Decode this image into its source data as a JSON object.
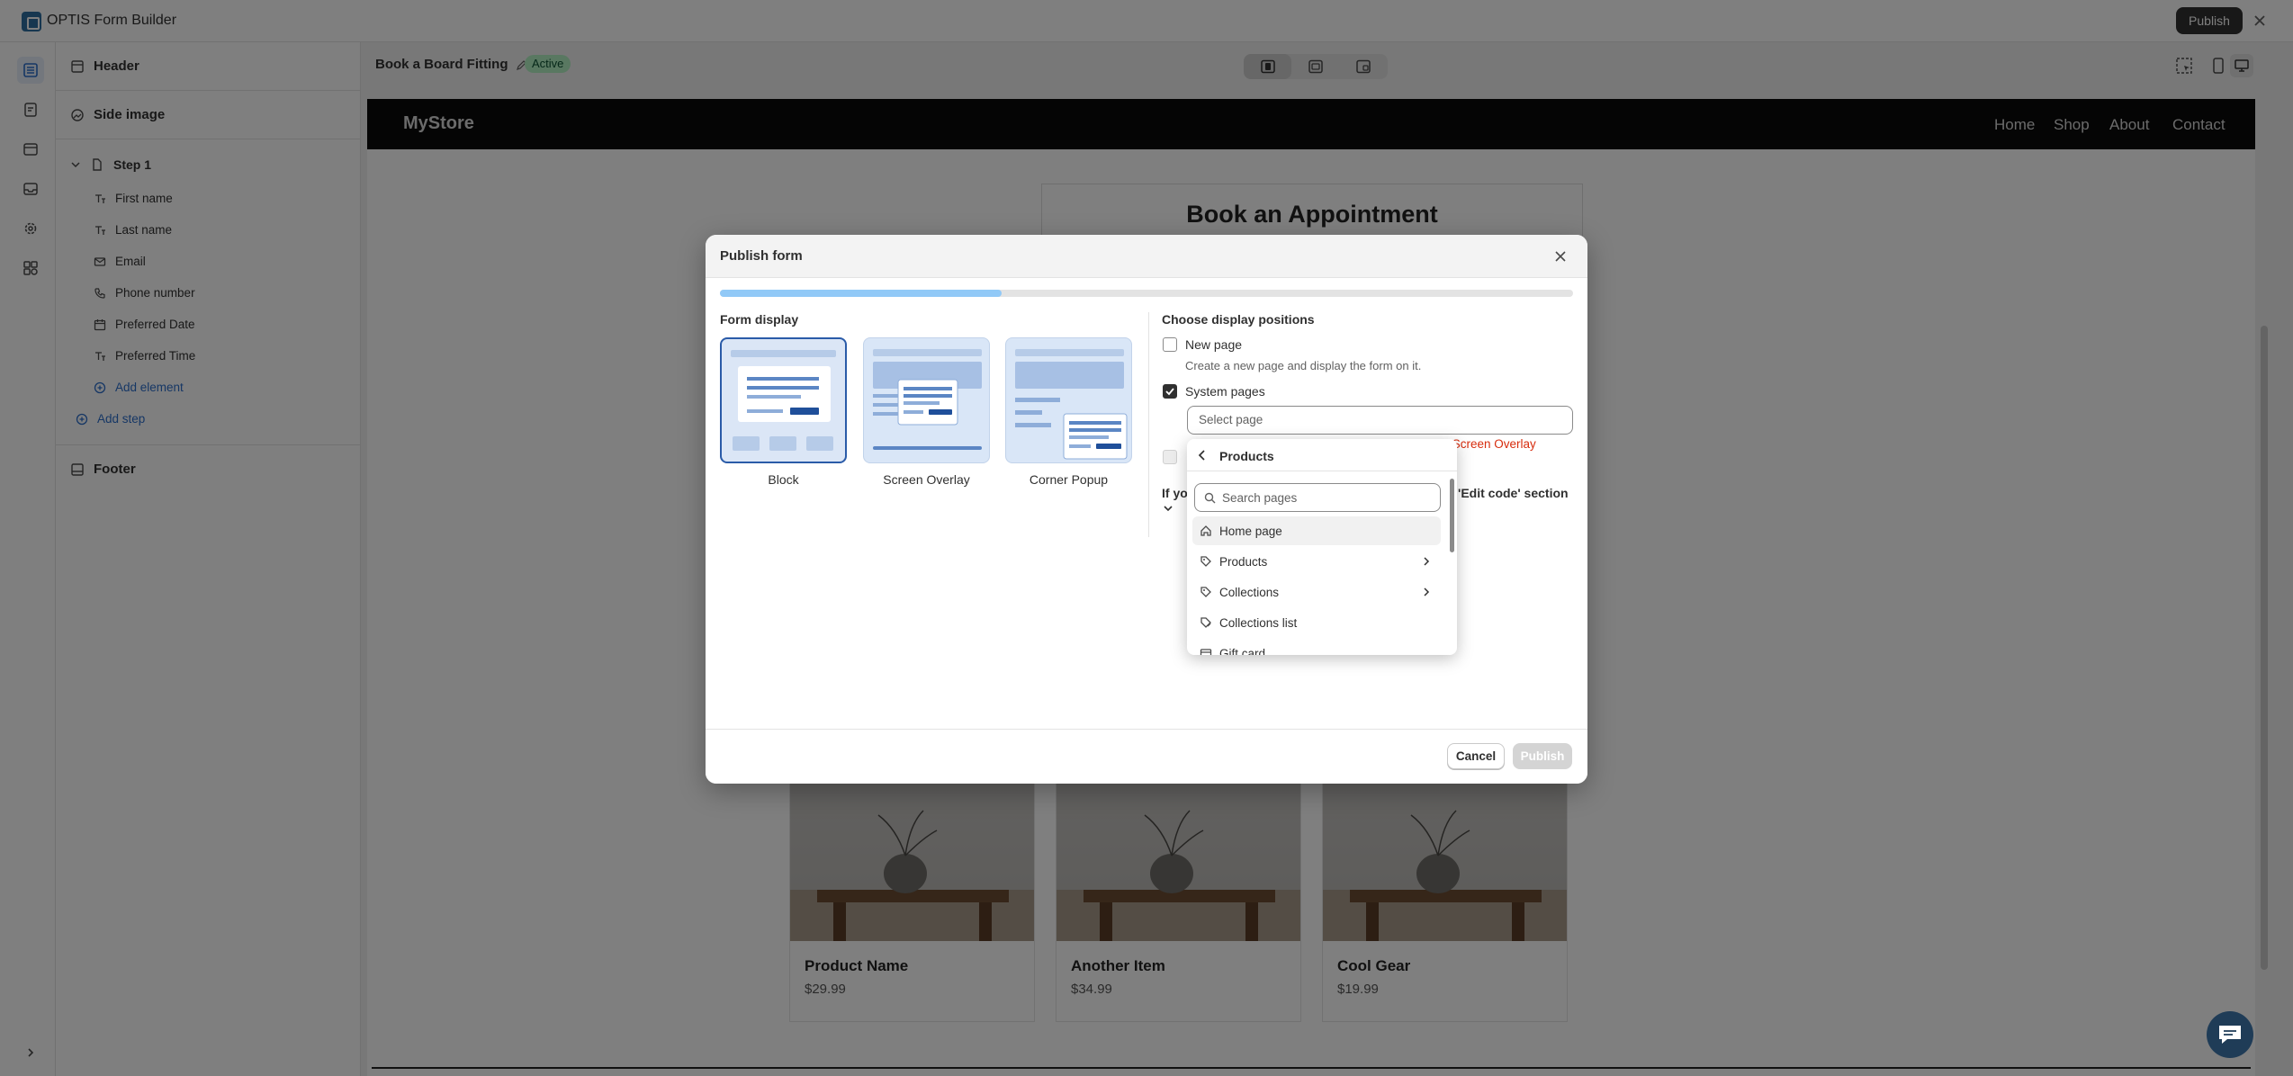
{
  "app": {
    "title": "OPTIS Form Builder",
    "publish_label": "Publish"
  },
  "sidebar": {
    "header": "Header",
    "side_image": "Side image",
    "step": "Step 1",
    "fields": [
      "First name",
      "Last name",
      "Email",
      "Phone number",
      "Preferred Date",
      "Preferred Time"
    ],
    "add_element": "Add element",
    "add_step": "Add step",
    "footer": "Footer"
  },
  "editor": {
    "form_name": "Book a Board Fitting",
    "status": "Active"
  },
  "store": {
    "name": "MyStore",
    "nav": [
      "Home",
      "Shop",
      "About",
      "Contact"
    ],
    "form_title": "Book an Appointment",
    "products": [
      {
        "name": "Product Name",
        "price": "$29.99"
      },
      {
        "name": "Another Item",
        "price": "$34.99"
      },
      {
        "name": "Cool Gear",
        "price": "$19.99"
      }
    ]
  },
  "modal": {
    "title": "Publish form",
    "progress": 0.33,
    "form_display_label": "Form display",
    "options": [
      "Block",
      "Screen Overlay",
      "Corner Popup"
    ],
    "selected_option": "Block",
    "positions_label": "Choose display positions",
    "new_page_label": "New page",
    "new_page_help": "Create a new page and display the form on it.",
    "system_pages_label": "System pages",
    "select_placeholder": "Select page",
    "error_fragment": "es: Screen Overlay",
    "if_fragment": "If yo",
    "code_fragment": "'Edit code' section",
    "cancel_label": "Cancel",
    "publish_label": "Publish"
  },
  "dropdown": {
    "title": "Products",
    "search_placeholder": "Search pages",
    "items": [
      {
        "label": "Home page",
        "icon": "home-icon"
      },
      {
        "label": "Products",
        "icon": "tag-icon",
        "has_children": true
      },
      {
        "label": "Collections",
        "icon": "tag-icon",
        "has_children": true
      },
      {
        "label": "Collections list",
        "icon": "collections-icon"
      },
      {
        "label": "Gift card",
        "icon": "gift-card-icon"
      }
    ]
  },
  "colors": {
    "accent": "#2c6ecb",
    "progress": "#91c9f7",
    "error": "#d72c0d",
    "selected_border": "#2a5ba8"
  }
}
